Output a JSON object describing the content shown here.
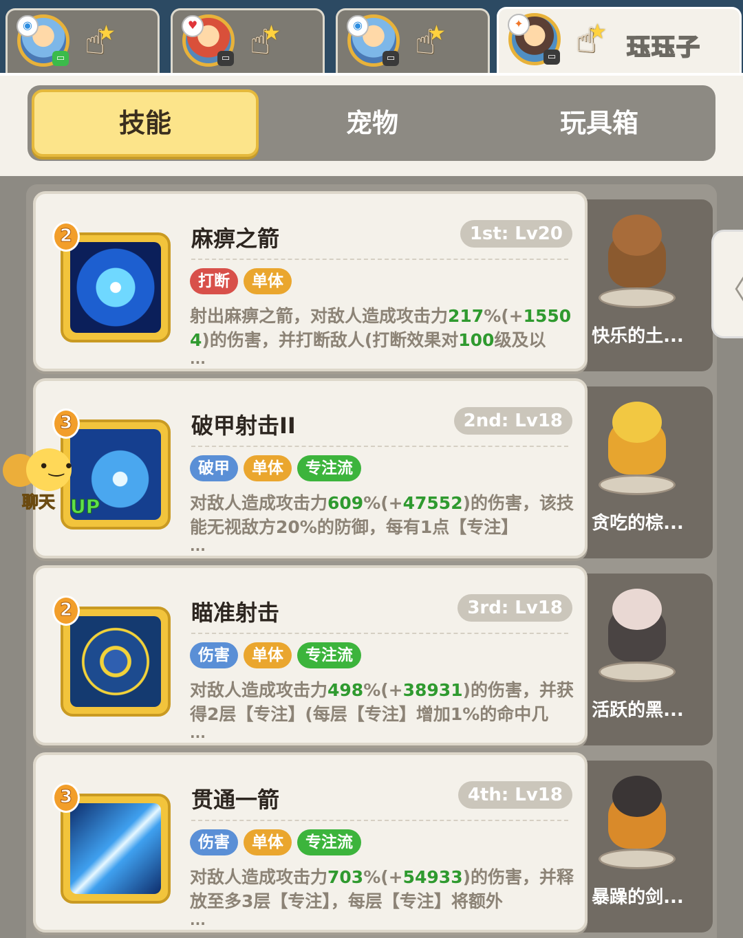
{
  "characters": [
    {
      "class_icon": "water-class-icon",
      "status": "online"
    },
    {
      "class_icon": "heart-class-icon",
      "status": "offline"
    },
    {
      "class_icon": "water-class-icon",
      "status": "offline"
    },
    {
      "class_icon": "fire-class-icon",
      "status": "offline",
      "name": "珏珏子"
    }
  ],
  "tabs": [
    "技能",
    "宠物",
    "玩具箱"
  ],
  "skills": [
    {
      "level": "2",
      "name": "麻痹之箭",
      "rank": "1st: Lv20",
      "tags": [
        "打断",
        "单体"
      ],
      "desc_a": "射出麻痹之箭，对敌人造成攻击力",
      "desc_b": "217",
      "desc_c": "%(+",
      "desc_d": "15504",
      "desc_e": ")的伤害，并打断敌人(打断效果对",
      "desc_f": "100",
      "desc_g": "级及以",
      "more": "...",
      "pet_name": "快乐的土..."
    },
    {
      "level": "3",
      "name": "破甲射击II",
      "rank": "2nd: Lv18",
      "tags": [
        "破甲",
        "单体",
        "专注流"
      ],
      "desc_a": "对敌人造成攻击力",
      "desc_b": "609",
      "desc_c": "%(+",
      "desc_d": "47552",
      "desc_e": ")的伤害，该技能无视敌方20%的防御，每有1点【专注】",
      "more": "...",
      "up": "UP",
      "pet_name": "贪吃的棕..."
    },
    {
      "level": "2",
      "name": "瞄准射击",
      "rank": "3rd: Lv18",
      "tags": [
        "伤害",
        "单体",
        "专注流"
      ],
      "desc_a": "对敌人造成攻击力",
      "desc_b": "498",
      "desc_c": "%(+",
      "desc_d": "38931",
      "desc_e": ")的伤害，并获得2层【专注】(每层【专注】增加1%的命中几",
      "more": "...",
      "pet_name": "活跃的黑..."
    },
    {
      "level": "3",
      "name": "贯通一箭",
      "rank": "4th: Lv18",
      "tags": [
        "伤害",
        "单体",
        "专注流"
      ],
      "desc_a": "对敌人造成攻击力",
      "desc_b": "703",
      "desc_c": "%(+",
      "desc_d": "54933",
      "desc_e": ")的伤害，并释放至多3层【专注】，每层【专注】将额外",
      "more": "...",
      "pet_name": "暴躁的剑..."
    }
  ],
  "chat": {
    "label": "聊天"
  },
  "colors": {
    "accent_yellow": "#fce48a",
    "highlight_green": "#2f9a2f",
    "tag_red": "#d8504a",
    "tag_orange": "#eaa62e",
    "tag_blue": "#5a8fd6",
    "tag_green": "#3cb43c"
  }
}
